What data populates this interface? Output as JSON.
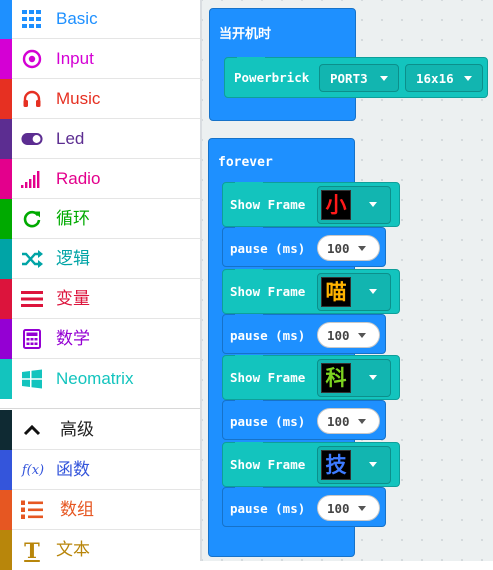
{
  "toolbox": {
    "categories": [
      {
        "label": "Basic",
        "color": "#1e90ff",
        "icon": "grid-icon"
      },
      {
        "label": "Input",
        "color": "#d400d4",
        "icon": "target-icon"
      },
      {
        "label": "Music",
        "color": "#e63022",
        "icon": "headphones-icon"
      },
      {
        "label": "Led",
        "color": "#5c2d91",
        "icon": "toggle-icon"
      },
      {
        "label": "Radio",
        "color": "#e3008c",
        "icon": "signal-bars-icon"
      },
      {
        "label": "循环",
        "color": "#00aa00",
        "icon": "refresh-icon"
      },
      {
        "label": "逻辑",
        "color": "#00a4a6",
        "icon": "shuffle-icon"
      },
      {
        "label": "变量",
        "color": "#dc143c",
        "icon": "lines-icon"
      },
      {
        "label": "数学",
        "color": "#9400d3",
        "icon": "calculator-icon"
      },
      {
        "label": "Neomatrix",
        "color": "#13c4be",
        "icon": "windows-icon"
      }
    ],
    "advanced": [
      {
        "label": "高级",
        "color": "#0f2a33",
        "text_color": "#222222",
        "icon": "chevron-up-icon"
      },
      {
        "label": "函数",
        "color": "#3455db",
        "icon": "function-icon",
        "icon_text": "f(x)"
      },
      {
        "label": "数组",
        "color": "#e65722",
        "icon": "numbered-list-icon"
      },
      {
        "label": "文本",
        "color": "#b8860b",
        "icon": "text-icon",
        "icon_text": "T"
      }
    ]
  },
  "workspace": {
    "on_start": {
      "title": "当开机时",
      "block_label": "Powerbrick",
      "port": "PORT3",
      "size": "16x16"
    },
    "forever": {
      "title": "forever",
      "show_frame_label": "Show Frame",
      "pause_label": "pause (ms)",
      "frames": [
        {
          "char": "小",
          "color": "#ff1a1a",
          "pause": "100"
        },
        {
          "char": "喵",
          "color": "#ffb300",
          "pause": "100"
        },
        {
          "char": "科",
          "color": "#7cd420",
          "pause": "100"
        },
        {
          "char": "技",
          "color": "#3d7bff",
          "pause": "100"
        }
      ]
    }
  }
}
